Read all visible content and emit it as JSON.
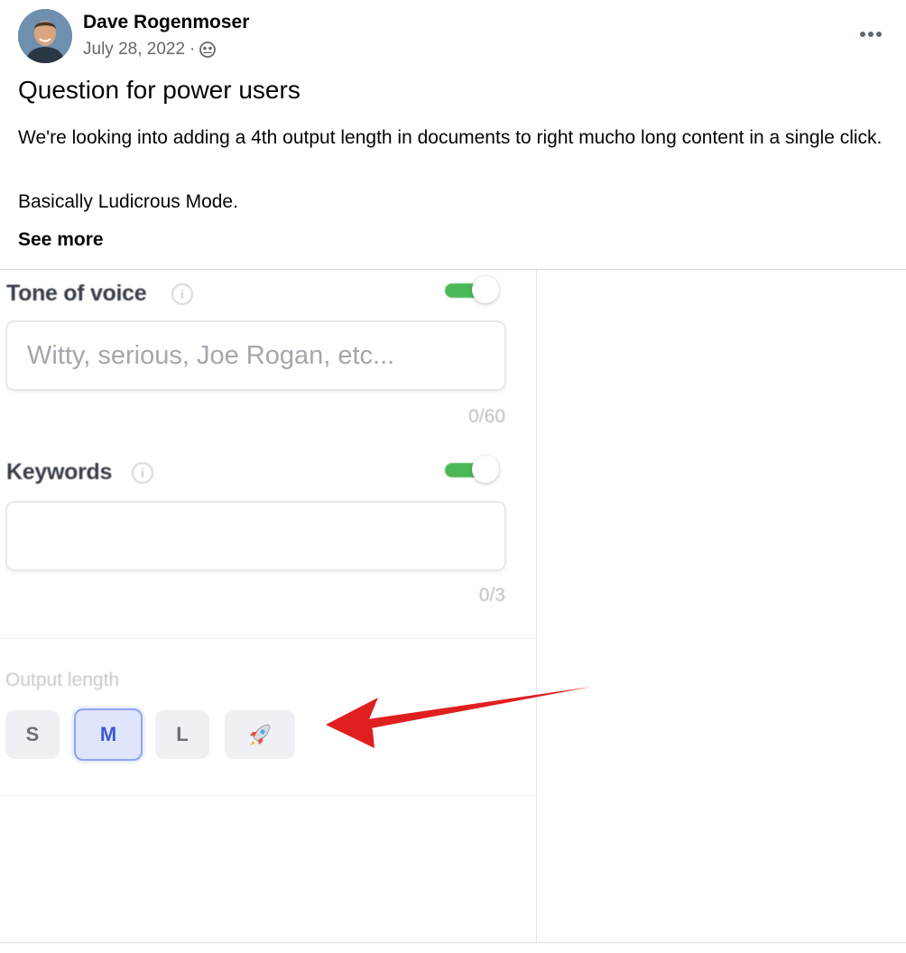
{
  "post": {
    "author": "Dave Rogenmoser",
    "date": "July 28, 2022",
    "separator": "·",
    "audience_icon": "group-icon",
    "title": "Question for power users",
    "paragraph1": "We're looking into adding a 4th output length in documents to right mucho long content in a single click.",
    "paragraph2": "Basically Ludicrous Mode.",
    "see_more": "See more"
  },
  "attachment": {
    "tone": {
      "label": "Tone of voice",
      "placeholder": "Witty, serious, Joe Rogan, etc...",
      "counter": "0/60",
      "toggle_on": true
    },
    "keywords": {
      "label": "Keywords",
      "value": "",
      "counter": "0/3",
      "toggle_on": true
    },
    "output_length": {
      "label": "Output length",
      "options": [
        "S",
        "M",
        "L",
        "🚀"
      ],
      "selected": "M"
    },
    "arrow_icon": "red-arrow-icon"
  },
  "colors": {
    "toggle_on": "#4bb857",
    "selected_border": "#8ea3f2",
    "selected_text": "#3f56d8",
    "arrow": "#e02020"
  }
}
